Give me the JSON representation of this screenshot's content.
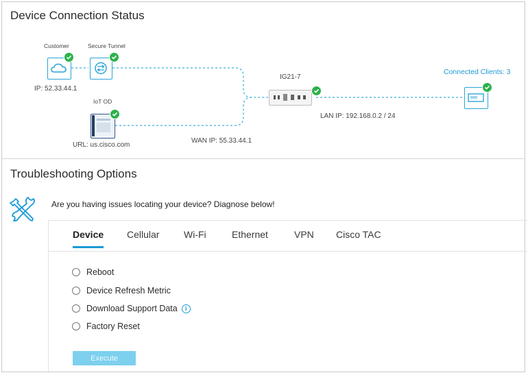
{
  "connection": {
    "title": "Device Connection Status",
    "customer": {
      "label": "Customer",
      "ip": "IP: 52.33.44.1",
      "icon": "cloud-icon"
    },
    "secure_tunnel": {
      "label": "Secure Tunnel",
      "icon": "tunnel-icon"
    },
    "iot_od": {
      "label": "IoT OD",
      "url": "URL: us.cisco.com",
      "icon": "iot-od-icon"
    },
    "router": {
      "name": "IG21-7",
      "lan_ip": "LAN IP: 192.168.0.2 / 24",
      "wan_ip": "WAN IP: 55.33.44.1",
      "icon": "router-icon"
    },
    "clients": {
      "label": "Connected Clients: 3",
      "icon": "client-device-icon"
    },
    "status_icon": "check-circle-icon",
    "colors": {
      "line": "#5bbde4",
      "node": "#2aa5d6",
      "ok": "#2bb24c"
    }
  },
  "troubleshooting": {
    "title": "Troubleshooting Options",
    "icon": "wrench-screwdriver-icon",
    "question": "Are you having issues locating your device? Diagnose below!",
    "tabs": [
      {
        "label": "Device",
        "active": true
      },
      {
        "label": "Cellular"
      },
      {
        "label": "Wi-Fi"
      },
      {
        "label": "Ethernet"
      },
      {
        "label": "VPN"
      },
      {
        "label": "Cisco TAC"
      }
    ],
    "options": [
      {
        "label": "Reboot"
      },
      {
        "label": "Device Refresh Metric"
      },
      {
        "label": "Download Support Data",
        "info_icon": "info-icon"
      },
      {
        "label": "Factory Reset"
      }
    ],
    "execute_label": "Execute",
    "accent": "#1a9ad6"
  }
}
